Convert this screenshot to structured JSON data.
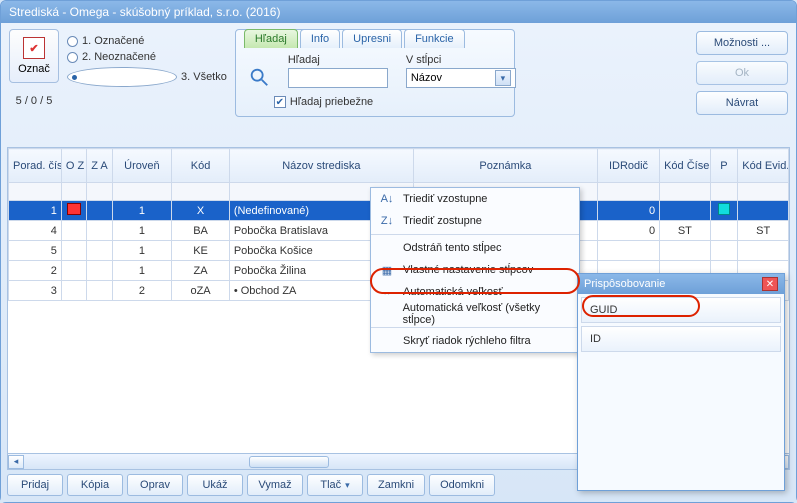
{
  "window": {
    "title": "Strediská - Omega - skúšobný príklad, s.r.o. (2016)"
  },
  "oznac": {
    "label": "Označ"
  },
  "radios": {
    "r1": "1. Označené",
    "r2": "2. Neoznačené",
    "r3": "3. Všetko"
  },
  "counter": "5 / 0 / 5",
  "tabs": {
    "t1": "Hľadaj",
    "t2": "Info",
    "t3": "Upresni",
    "t4": "Funkcie"
  },
  "search": {
    "label": "Hľadaj",
    "col_label": "V stĺpci",
    "col_value": "Názov",
    "live_label": "Hľadaj priebežne"
  },
  "right_buttons": {
    "options": "Možnosti ...",
    "ok": "Ok",
    "back": "Návrat"
  },
  "grid": {
    "headers": {
      "porad": "Porad. číslo",
      "oz": "O Z",
      "za": "Z A",
      "uroven": "Úroveň",
      "kod": "Kód",
      "nazov": "Názov strediska",
      "poznamka": "Poznámka",
      "idrodic": "IDRodič",
      "kodcisel": "Kód Čísel.",
      "p": "P",
      "kodevid": "Kód Evid."
    },
    "rows": [
      {
        "porad": "1",
        "uroven": "1",
        "kod": "X",
        "nazov": "(Nedefinované)",
        "idrodic": "0",
        "kodcisel": "",
        "p": "sq",
        "kodevid": "",
        "sel": true,
        "oz": true
      },
      {
        "porad": "4",
        "uroven": "1",
        "kod": "BA",
        "nazov": "Pobočka Bratislava",
        "idrodic": "0",
        "kodcisel": "ST",
        "p": "",
        "kodevid": "ST"
      },
      {
        "porad": "5",
        "uroven": "1",
        "kod": "KE",
        "nazov": "Pobočka Košice",
        "idrodic": "",
        "kodcisel": "",
        "p": "",
        "kodevid": ""
      },
      {
        "porad": "2",
        "uroven": "1",
        "kod": "ZA",
        "nazov": "Pobočka Žilina",
        "idrodic": "",
        "kodcisel": "",
        "p": "",
        "kodevid": ""
      },
      {
        "porad": "3",
        "uroven": "2",
        "kod": "oZA",
        "nazov": "   • Obchod ZA",
        "idrodic": "",
        "kodcisel": "",
        "p": "",
        "kodevid": ""
      }
    ]
  },
  "context_menu": {
    "sort_asc": "Triediť vzostupne",
    "sort_desc": "Triediť zostupne",
    "remove_col": "Odstráň tento stĺpec",
    "custom_cols": "Vlastné nastavenie stĺpcov",
    "auto_size": "Automatická veľkosť",
    "auto_size_all": "Automatická veľkosť (všetky stĺpce)",
    "hide_filter": "Skryť riadok rýchleho filtra"
  },
  "customizer": {
    "title": "Prispôsobovanie",
    "items": {
      "guid": "GUID",
      "id": "ID"
    }
  },
  "bottom": {
    "pridaj": "Pridaj",
    "kopia": "Kópia",
    "oprav": "Oprav",
    "ukaz": "Ukáž",
    "vymaz": "Vymaž",
    "tlac": "Tlač",
    "zamkni": "Zamkni",
    "odomkni": "Odomkni"
  }
}
